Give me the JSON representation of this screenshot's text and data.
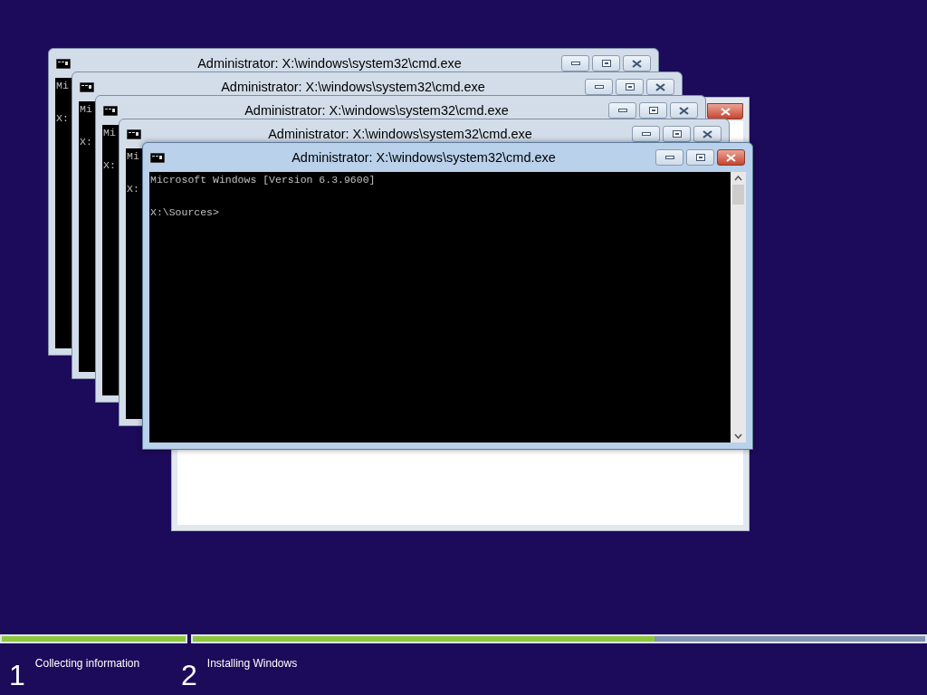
{
  "dialog": {
    "kind": "window"
  },
  "windows": [
    {
      "title": "Administrator: X:\\windows\\system32\\cmd.exe",
      "active": false,
      "lines": [
        "Mi",
        "X:"
      ]
    },
    {
      "title": "Administrator: X:\\windows\\system32\\cmd.exe",
      "active": false,
      "lines": [
        "Mi",
        "X:"
      ]
    },
    {
      "title": "Administrator: X:\\windows\\system32\\cmd.exe",
      "active": false,
      "lines": [
        "Mi",
        "X:"
      ]
    },
    {
      "title": "Administrator: X:\\windows\\system32\\cmd.exe",
      "active": false,
      "lines": [
        "Mi",
        "X:"
      ]
    },
    {
      "title": "Administrator: X:\\windows\\system32\\cmd.exe",
      "active": true,
      "lines": [
        "Microsoft Windows [Version 6.3.9600]",
        "X:\\Sources>"
      ]
    }
  ],
  "steps": [
    {
      "number": "1",
      "label": "Collecting information",
      "level": 1
    },
    {
      "number": "2",
      "label": "Installing Windows",
      "level": 0.63
    }
  ]
}
